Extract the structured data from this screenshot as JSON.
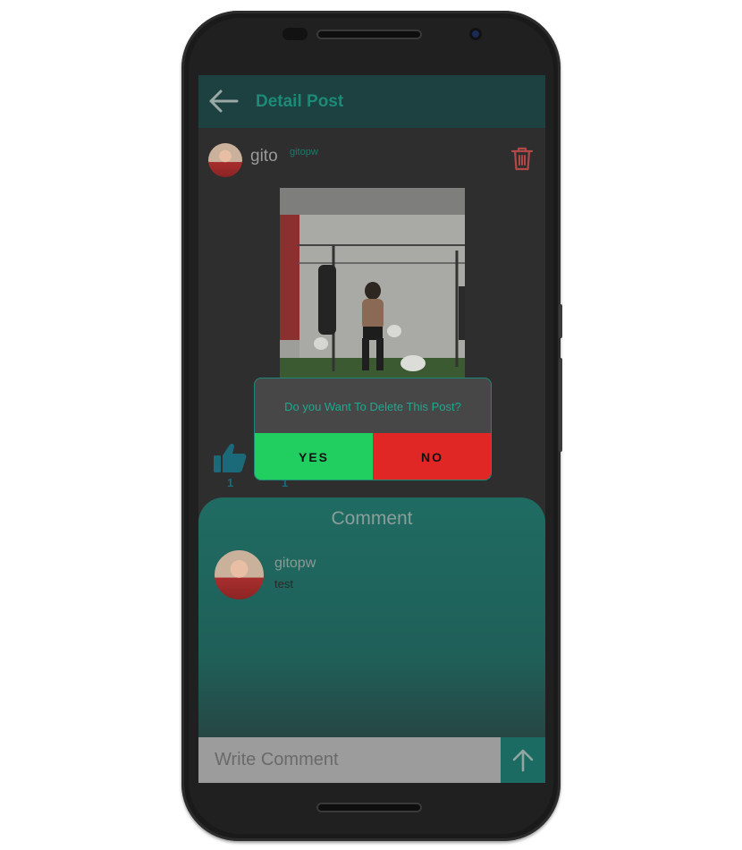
{
  "header": {
    "title": "Detail Post"
  },
  "post": {
    "username": "gito",
    "handle": "gitopw",
    "like_count": "1",
    "comment_count": "1"
  },
  "comments": {
    "heading": "Comment",
    "items": [
      {
        "user": "gitopw",
        "text": "test"
      }
    ],
    "input_placeholder": "Write Comment"
  },
  "dialog": {
    "message": "Do you Want To Delete This Post?",
    "yes_label": "YES",
    "no_label": "NO"
  },
  "icons": {
    "back": "arrow-left-icon",
    "delete": "trash-icon",
    "like": "thumbs-up-icon",
    "send": "arrow-up-icon"
  },
  "colors": {
    "accent": "#1d8a78",
    "yes": "#21cf61",
    "no": "#e12626",
    "delete": "#c04a4a"
  }
}
